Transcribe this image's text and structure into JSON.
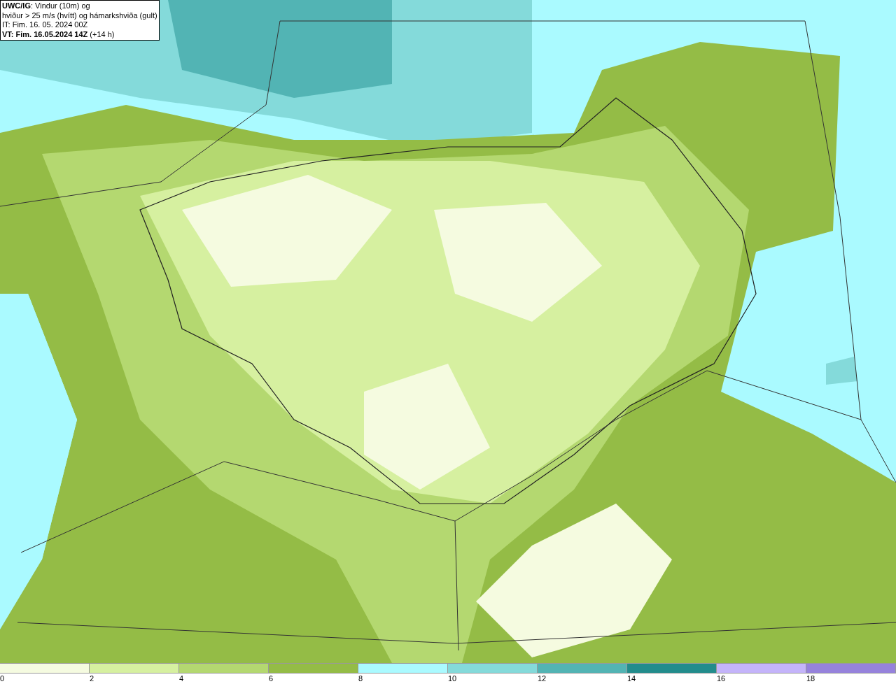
{
  "info_box": {
    "lines": [
      "**UWC/IG**: Vindur (10m) og",
      "hviður > 25 m/s (hvítt) og hámarkshviða (gult)",
      "IT: Fim. 16. 05. 2024 00Z",
      "**VT: Fim. 16.05.2024 14Z** (+14 h)"
    ]
  },
  "legend": [
    {
      "label": "0",
      "color": "#f5fbe0"
    },
    {
      "label": "2",
      "color": "#d6f0a0"
    },
    {
      "label": "4",
      "color": "#b4d870"
    },
    {
      "label": "6",
      "color": "#94bc46"
    },
    {
      "label": "8",
      "color": "#aafaff"
    },
    {
      "label": "10",
      "color": "#84dada"
    },
    {
      "label": "12",
      "color": "#52b4b4"
    },
    {
      "label": "14",
      "color": "#228c8c"
    },
    {
      "label": "16",
      "color": "#c4b4fa"
    },
    {
      "label": "18",
      "color": "#9682dc"
    }
  ]
}
